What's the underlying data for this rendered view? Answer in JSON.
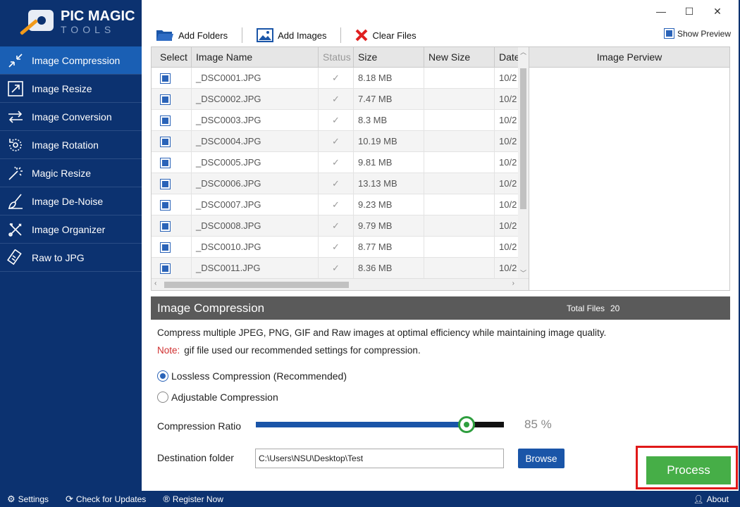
{
  "logo": {
    "line1": "PIC MAGIC",
    "line2": "TOOLS"
  },
  "window": {
    "minimize": "—",
    "maximize": "☐",
    "close": "✕"
  },
  "sidebar": {
    "items": [
      {
        "label": "Image Compression",
        "icon": "compress-icon",
        "active": true
      },
      {
        "label": "Image Resize",
        "icon": "resize-icon"
      },
      {
        "label": "Image Conversion",
        "icon": "convert-icon"
      },
      {
        "label": "Image Rotation",
        "icon": "rotate-icon"
      },
      {
        "label": "Magic Resize",
        "icon": "magic-wand-icon"
      },
      {
        "label": "Image De-Noise",
        "icon": "broom-icon"
      },
      {
        "label": "Image Organizer",
        "icon": "tools-icon"
      },
      {
        "label": "Raw to JPG",
        "icon": "film-icon"
      }
    ]
  },
  "toolbar": {
    "add_folders": "Add Folders",
    "add_images": "Add Images",
    "clear_files": "Clear Files",
    "show_preview": "Show Preview"
  },
  "table": {
    "columns": [
      "Select",
      "Image Name",
      "Status",
      "Size",
      "New Size",
      "Date"
    ],
    "rows": [
      {
        "name": "_DSC0001.JPG",
        "status": "✓",
        "size": "8.18 MB",
        "new_size": "",
        "date": "10/2"
      },
      {
        "name": "_DSC0002.JPG",
        "status": "✓",
        "size": "7.47 MB",
        "new_size": "",
        "date": "10/2"
      },
      {
        "name": "_DSC0003.JPG",
        "status": "✓",
        "size": "8.3 MB",
        "new_size": "",
        "date": "10/2"
      },
      {
        "name": "_DSC0004.JPG",
        "status": "✓",
        "size": "10.19 MB",
        "new_size": "",
        "date": "10/2"
      },
      {
        "name": "_DSC0005.JPG",
        "status": "✓",
        "size": "9.81 MB",
        "new_size": "",
        "date": "10/2"
      },
      {
        "name": "_DSC0006.JPG",
        "status": "✓",
        "size": "13.13 MB",
        "new_size": "",
        "date": "10/2"
      },
      {
        "name": "_DSC0007.JPG",
        "status": "✓",
        "size": "9.23 MB",
        "new_size": "",
        "date": "10/2"
      },
      {
        "name": "_DSC0008.JPG",
        "status": "✓",
        "size": "9.79 MB",
        "new_size": "",
        "date": "10/2"
      },
      {
        "name": "_DSC0010.JPG",
        "status": "✓",
        "size": "8.77 MB",
        "new_size": "",
        "date": "10/2"
      },
      {
        "name": "_DSC0011.JPG",
        "status": "✓",
        "size": "8.36 MB",
        "new_size": "",
        "date": "10/2"
      }
    ]
  },
  "preview": {
    "title": "Image Perview"
  },
  "section": {
    "title": "Image Compression",
    "total_label": "Total Files",
    "total_count": "20",
    "description": "Compress multiple JPEG, PNG, GIF and Raw images at optimal efficiency while maintaining image quality.",
    "note_label": "Note:",
    "note_text": "gif file used our recommended settings for compression.",
    "option_lossless": "Lossless Compression (Recommended)",
    "option_adjustable": "Adjustable Compression",
    "ratio_label": "Compression Ratio",
    "ratio_value": 0.85,
    "ratio_text": "85 %",
    "destination_label": "Destination folder",
    "destination_value": "C:\\Users\\NSU\\Desktop\\Test",
    "browse": "Browse",
    "process": "Process"
  },
  "statusbar": {
    "settings": "Settings",
    "updates": "Check for Updates",
    "register": "Register Now",
    "about": "About"
  },
  "colors": {
    "sidebar": "#0c3270",
    "active": "#1a5fb4",
    "accent": "#1a55a8",
    "process": "#46ae47",
    "highlight": "#e01919"
  }
}
